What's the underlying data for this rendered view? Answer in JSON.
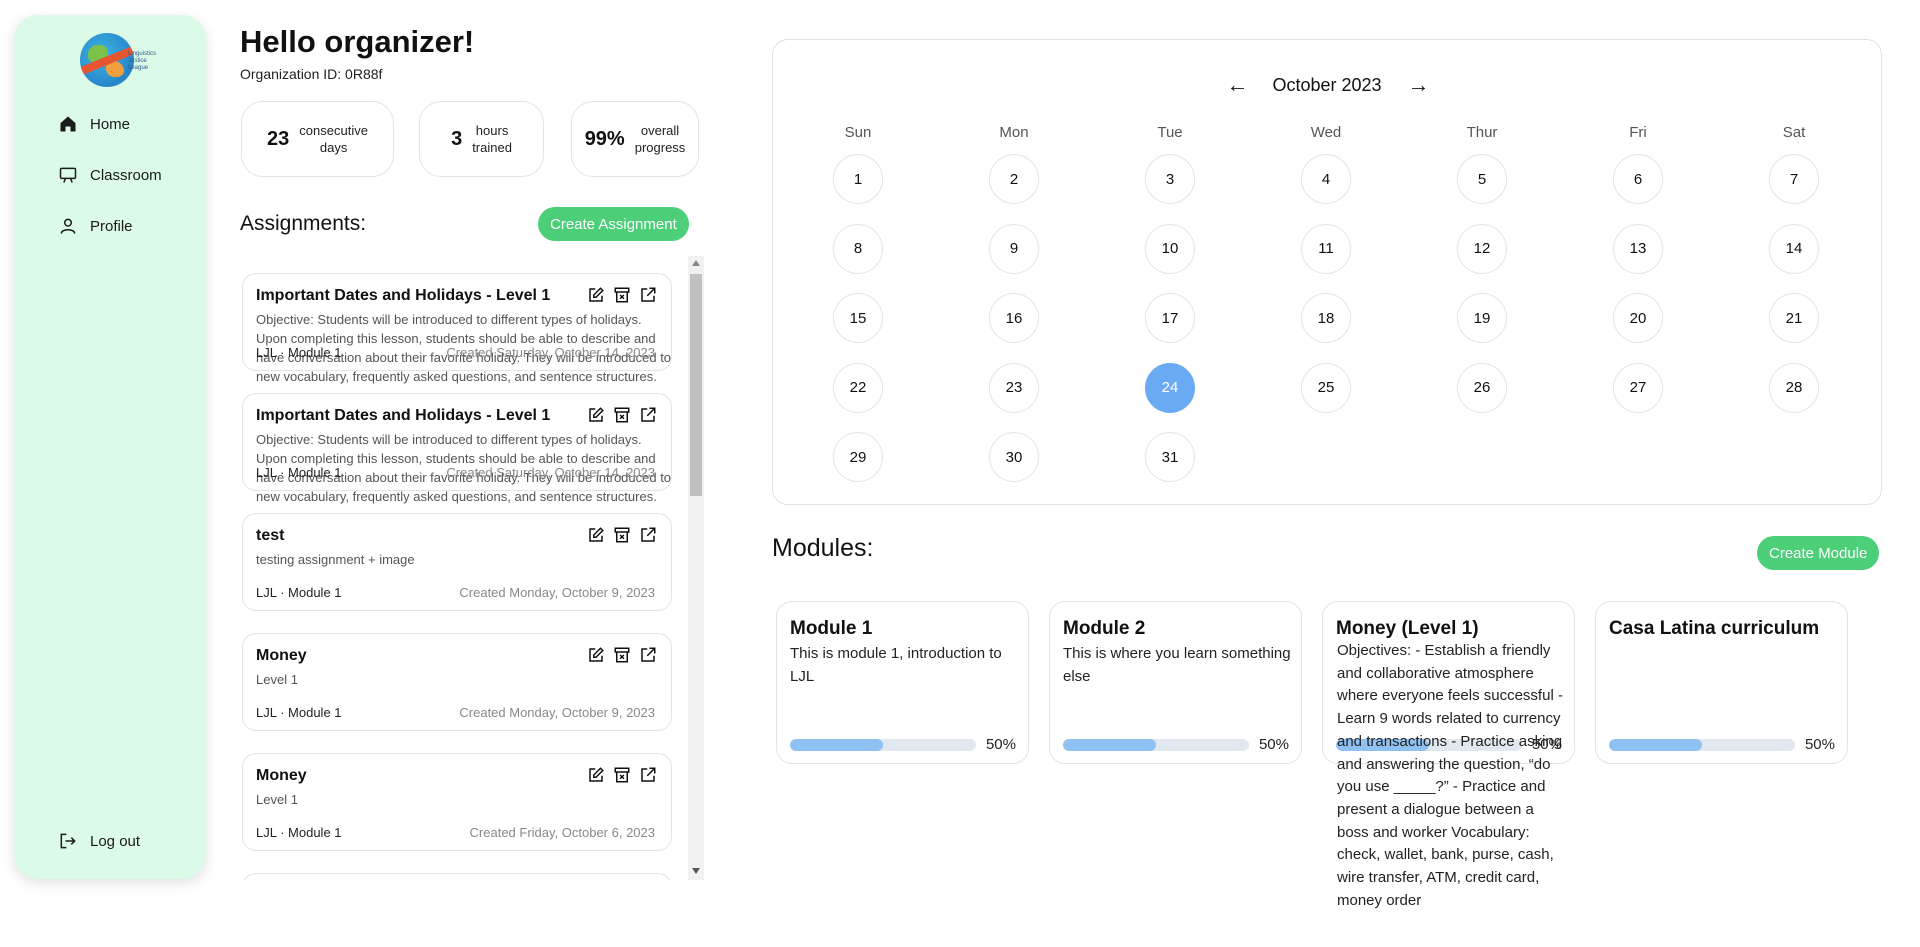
{
  "sidebar": {
    "logo_text": [
      "Linguistics",
      "Justice",
      "League"
    ],
    "items": [
      {
        "label": "Home",
        "icon": "home-icon"
      },
      {
        "label": "Classroom",
        "icon": "classroom-icon"
      },
      {
        "label": "Profile",
        "icon": "profile-icon"
      }
    ],
    "logout_label": "Log out"
  },
  "header": {
    "greeting": "Hello organizer!",
    "org_id": "Organization ID: 0R88f"
  },
  "stats": [
    {
      "value": "23",
      "label_line1": "consecutive",
      "label_line2": "days"
    },
    {
      "value": "3",
      "label_line1": "hours",
      "label_line2": "trained"
    },
    {
      "value": "99%",
      "label_line1": "overall",
      "label_line2": "progress"
    }
  ],
  "assignments": {
    "title": "Assignments:",
    "create_label": "Create Assignment",
    "items": [
      {
        "title": "Important Dates and Holidays - Level 1",
        "description": "Objective: Students will be introduced to different types of holidays. Upon completing this lesson, students should be able to describe and have conversation about their favorite holiday. They will be introduced to new vocabulary, frequently asked questions, and sentence structures.",
        "module": "LJL · Module 1",
        "created": "Created Saturday, October 14, 2023"
      },
      {
        "title": "Important Dates and Holidays - Level 1",
        "description": "Objective: Students will be introduced to different types of holidays. Upon completing this lesson, students should be able to describe and have conversation about their favorite holiday. They will be introduced to new vocabulary, frequently asked questions, and sentence structures.",
        "module": "LJL · Module 1",
        "created": "Created Saturday, October 14, 2023"
      },
      {
        "title": "test",
        "description": "testing assignment + image",
        "module": "LJL · Module 1",
        "created": "Created Monday, October 9, 2023"
      },
      {
        "title": "Money",
        "description": "Level 1",
        "module": "LJL · Module 1",
        "created": "Created Monday, October 9, 2023"
      },
      {
        "title": "Money",
        "description": "Level 1",
        "module": "LJL · Module 1",
        "created": "Created Friday, October 6, 2023"
      }
    ]
  },
  "calendar": {
    "month_label": "October 2023",
    "prev_icon": "arrow-left-icon",
    "next_icon": "arrow-right-icon",
    "weekdays": [
      "Sun",
      "Mon",
      "Tue",
      "Wed",
      "Thur",
      "Fri",
      "Sat"
    ],
    "first_weekday_index": 0,
    "days_in_month": 31,
    "selected_day": 24
  },
  "modules": {
    "title": "Modules:",
    "create_label": "Create Module",
    "items": [
      {
        "title": "Module 1",
        "description": "This is module 1, introduction to LJL",
        "progress": 0.5,
        "progress_label": "50%"
      },
      {
        "title": "Module 2",
        "description": "This is where you learn something else",
        "progress": 0.5,
        "progress_label": "50%"
      },
      {
        "title": "Money (Level 1)",
        "description": "Objectives: - Establish a friendly and collaborative atmosphere where everyone feels successful - Learn 9 words related to currency and transactions - Practice asking and answering the question, “do you use _____?” - Practice and present a dialogue between a boss and worker Vocabulary: check, wallet, bank, purse, cash, wire transfer, ATM, credit card, money order",
        "progress": 0.5,
        "progress_label": "50%"
      },
      {
        "title": "Casa Latina curriculum",
        "description": "",
        "progress": 0.5,
        "progress_label": "50%"
      }
    ]
  }
}
